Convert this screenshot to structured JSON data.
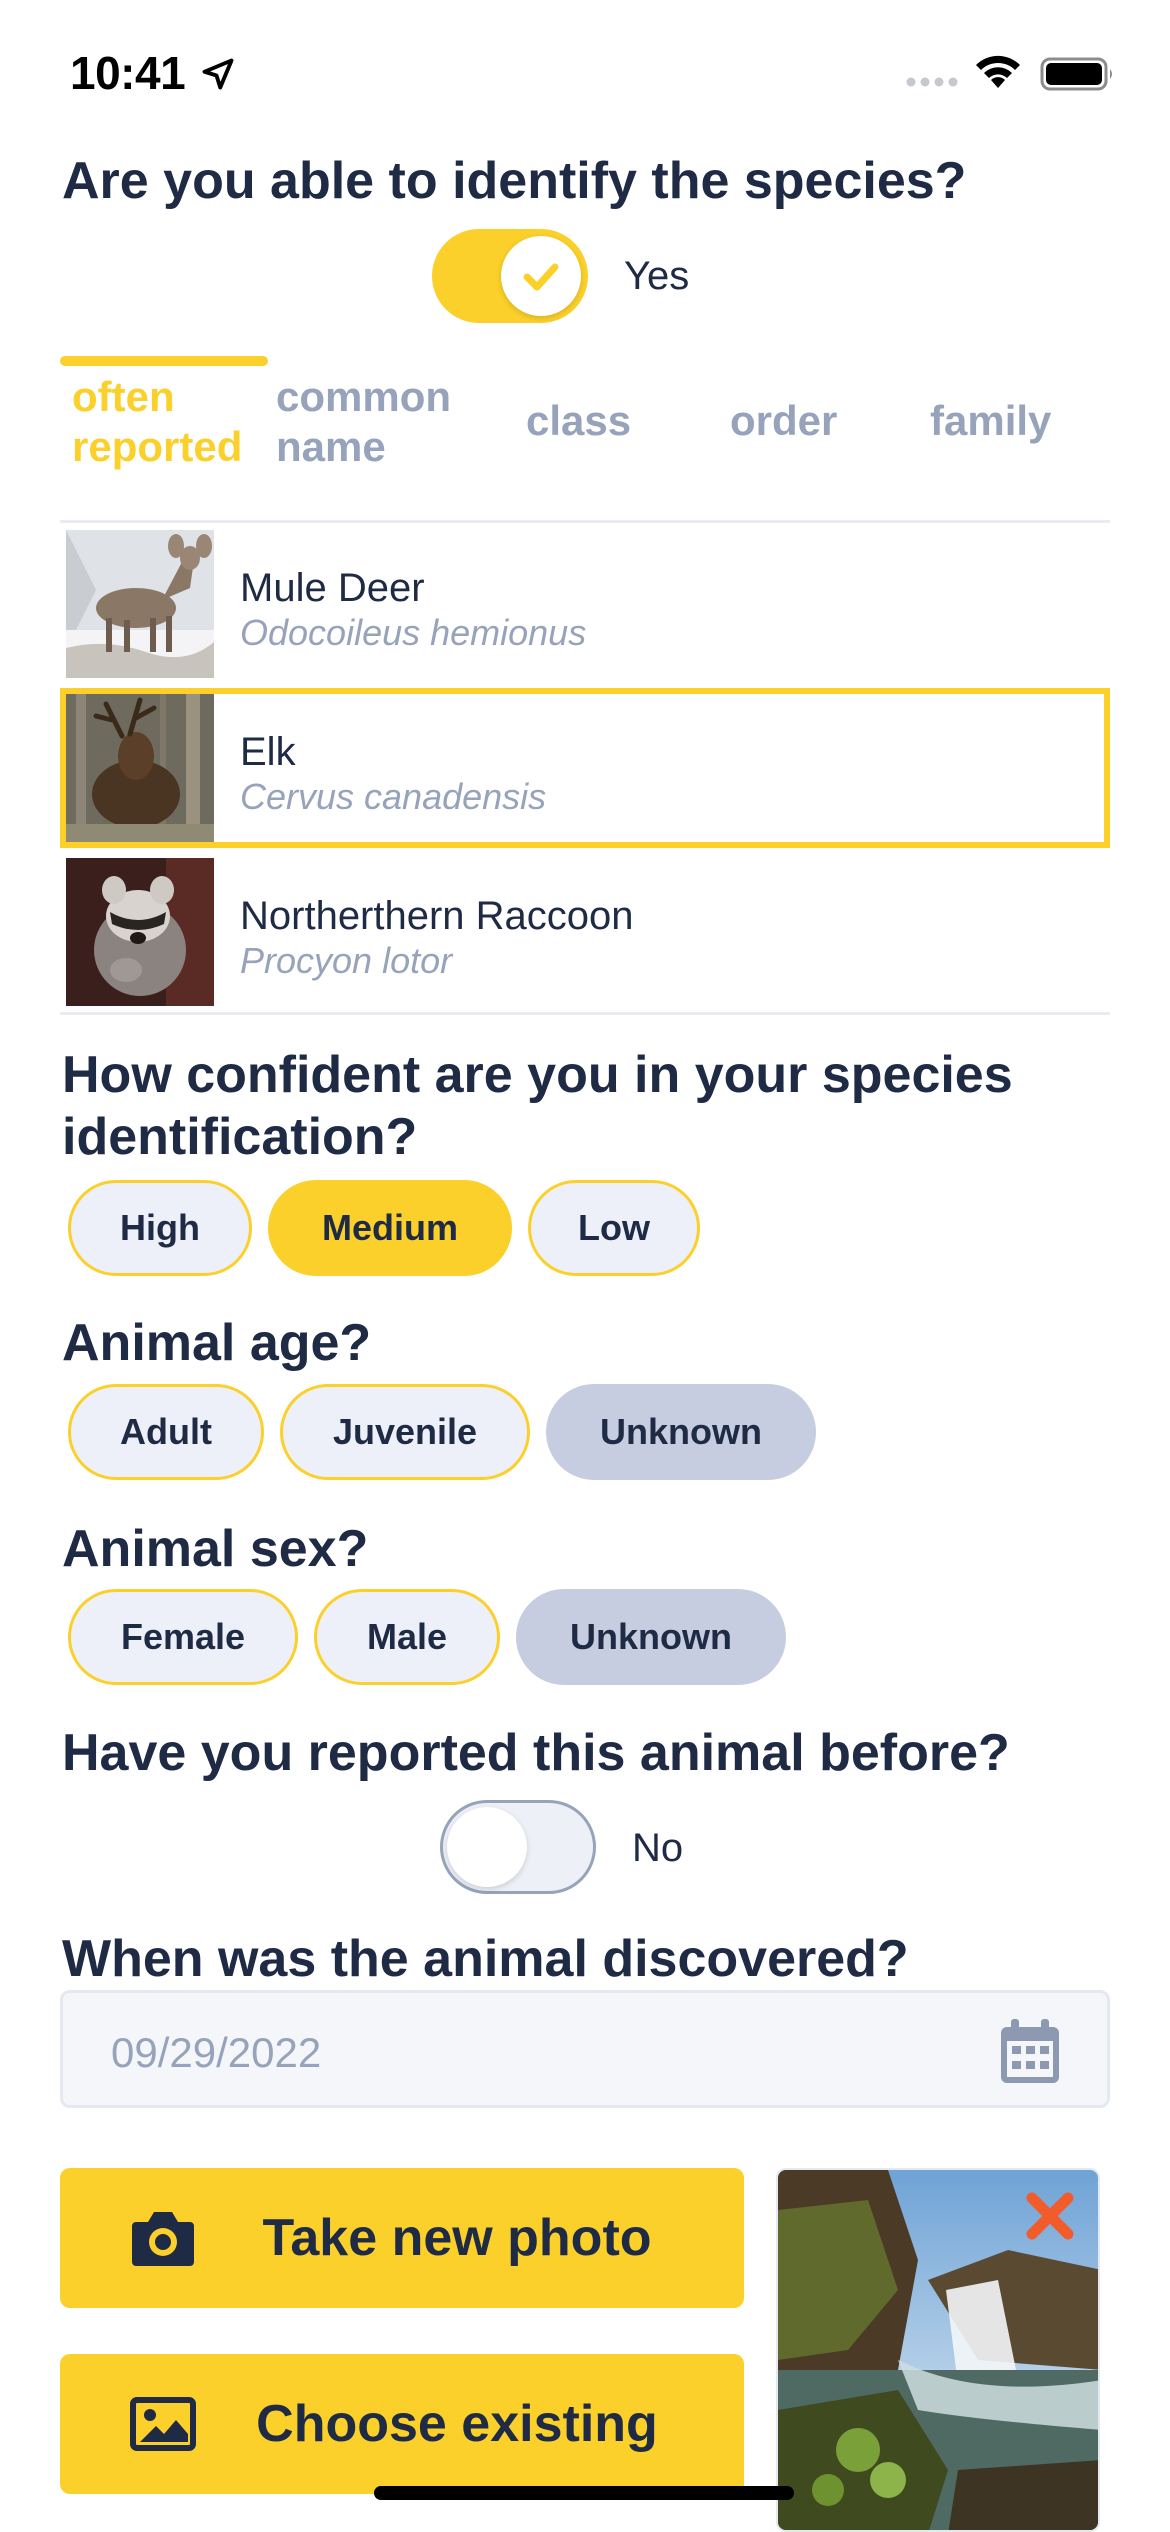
{
  "status_bar": {
    "time": "10:41"
  },
  "species_question": "Are you able to identify the species?",
  "identify_toggle": {
    "state": true,
    "label": "Yes"
  },
  "tabs": [
    {
      "line1": "often",
      "line2": "reported",
      "active": true
    },
    {
      "line1": "common",
      "line2": "name",
      "active": false
    },
    {
      "label": "class",
      "active": false
    },
    {
      "label": "order",
      "active": false
    },
    {
      "label": "family",
      "active": false
    }
  ],
  "species": [
    {
      "common": "Mule Deer",
      "scientific": "Odocoileus hemionus",
      "selected": false
    },
    {
      "common": "Elk",
      "scientific": "Cervus canadensis",
      "selected": true
    },
    {
      "common": "Northerthern Raccoon",
      "scientific": "Procyon lotor",
      "selected": false
    }
  ],
  "confidence": {
    "question": "How confident are you in your species identification?",
    "options": [
      "High",
      "Medium",
      "Low"
    ],
    "selected": "Medium"
  },
  "age": {
    "question": "Animal age?",
    "options": [
      "Adult",
      "Juvenile",
      "Unknown"
    ],
    "selected": "Unknown"
  },
  "sex": {
    "question": "Animal sex?",
    "options": [
      "Female",
      "Male",
      "Unknown"
    ],
    "selected": "Unknown"
  },
  "reported_before": {
    "question": "Have you reported this animal before?",
    "state": false,
    "label": "No"
  },
  "discovered": {
    "question": "When was the animal discovered?",
    "date": "09/29/2022"
  },
  "buttons": {
    "take_photo": "Take new photo",
    "choose_existing": "Choose existing"
  },
  "colors": {
    "accent": "#fbd02a",
    "text": "#1f2a44",
    "muted": "#97a3ba",
    "chip_bg": "#edf0f8",
    "unknown_bg": "#c6cde0",
    "remove": "#f25c2a"
  },
  "icons": [
    "location-arrow-icon",
    "signal-icon",
    "wifi-icon",
    "battery-icon",
    "check-icon",
    "calendar-icon",
    "camera-icon",
    "image-icon",
    "close-icon"
  ]
}
